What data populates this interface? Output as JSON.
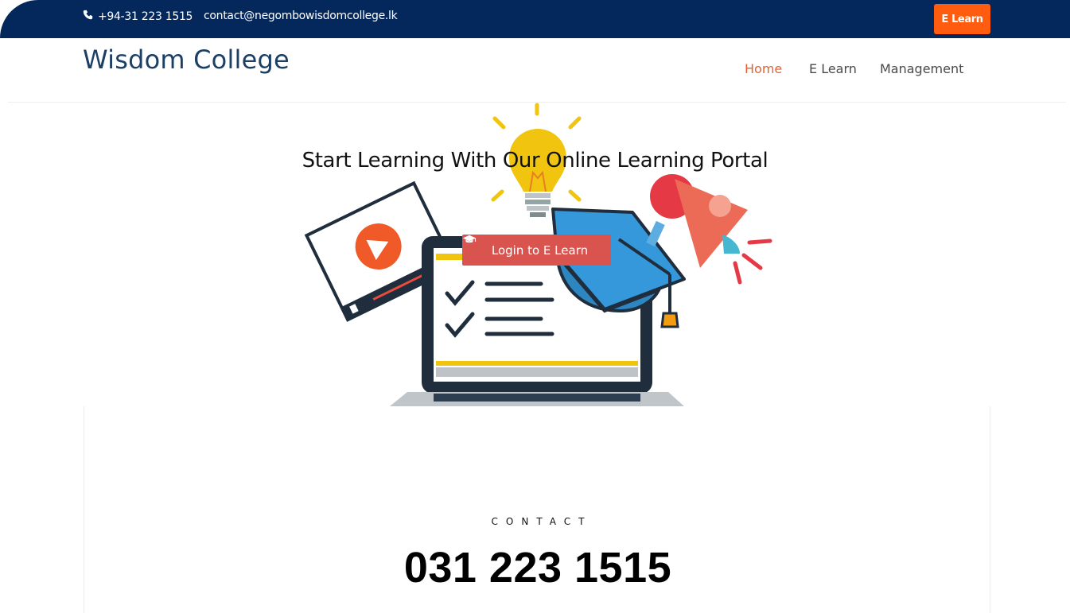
{
  "topbar": {
    "phone": "+94-31 223 1515",
    "email": "contact@negombowisdomcollege.lk",
    "elearn_button": "E Learn",
    "phone_icon": "phone-icon"
  },
  "header": {
    "brand": "Wisdom College",
    "nav": [
      {
        "label": "Home",
        "active": true
      },
      {
        "label": "E Learn",
        "active": false
      },
      {
        "label": "Management",
        "active": false
      }
    ]
  },
  "hero": {
    "title": "Start Learning With Our Online Learning Portal",
    "login_button": "Login to E Learn",
    "login_icon": "graduation-cap-icon"
  },
  "contact": {
    "label": "CONTACT",
    "number": "031 223 1515"
  },
  "colors": {
    "topbar_bg": "#04285c",
    "accent_orange": "#ff5c0f",
    "nav_active": "#e7622a",
    "login_button": "#d9534f",
    "brand": "#1c3f66"
  }
}
